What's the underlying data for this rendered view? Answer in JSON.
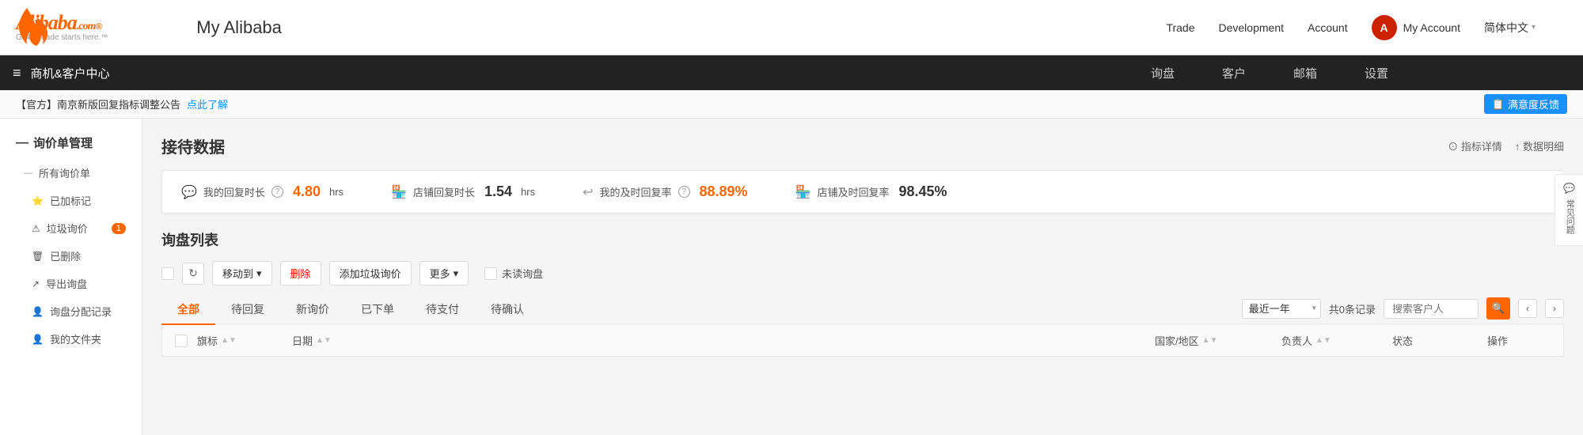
{
  "topNav": {
    "logo_brand": "Alibaba.com®",
    "logo_tagline": "Global trade starts here.™",
    "page_title": "My Alibaba",
    "links": [
      {
        "label": "Trade",
        "id": "trade"
      },
      {
        "label": "Development",
        "id": "development"
      },
      {
        "label": "Account",
        "id": "account"
      }
    ],
    "my_account_label": "My Account",
    "lang_label": "简体中文",
    "lang_arrow": "▾"
  },
  "secNav": {
    "menu_icon": "≡",
    "section_title": "商机&客户中心",
    "links": [
      {
        "label": "询盘",
        "id": "inquiry"
      },
      {
        "label": "客户",
        "id": "customer"
      },
      {
        "label": "邮箱",
        "id": "mailbox"
      },
      {
        "label": "设置",
        "id": "settings"
      }
    ]
  },
  "announcement": {
    "text": "【官方】南京新版回复指标调整公告",
    "link_text": "点此了解",
    "satisfaction_label": "满意度反馈",
    "indicator_label": "⊙ 指标详情",
    "data_label": "↑ 数据明细"
  },
  "sidebar": {
    "section_title": "询价单管理",
    "collapse_icon": "—",
    "items": [
      {
        "label": "所有询价单",
        "id": "all",
        "indent": false,
        "badge": null
      },
      {
        "label": "已加标记",
        "id": "marked",
        "indent": true,
        "badge": null
      },
      {
        "label": "垃圾询价",
        "id": "spam",
        "indent": true,
        "badge": "1"
      },
      {
        "label": "已删除",
        "id": "deleted",
        "indent": true,
        "badge": null
      },
      {
        "label": "导出询盘",
        "id": "export",
        "indent": true,
        "badge": null
      },
      {
        "label": "询盘分配记录",
        "id": "assign",
        "indent": true,
        "badge": null
      },
      {
        "label": "我的文件夹",
        "id": "folder",
        "indent": true,
        "badge": null
      }
    ]
  },
  "content": {
    "title": "接待数据",
    "header_links": [
      {
        "label": "⊙ 指标详情",
        "id": "indicator"
      },
      {
        "label": "↑ 数据明细",
        "id": "data_detail"
      }
    ],
    "stats": [
      {
        "icon": "💬",
        "label": "我的回复时长",
        "help": true,
        "value": "4.80",
        "unit": "hrs",
        "value_color": "orange",
        "id": "my-reply-time"
      },
      {
        "icon": "🏪",
        "label": "店铺回复时长",
        "help": false,
        "value": "1.54",
        "unit": "hrs",
        "value_color": "black",
        "id": "shop-reply-time"
      },
      {
        "icon": "↩",
        "label": "我的及时回复率",
        "help": true,
        "value": "88.89%",
        "unit": "",
        "value_color": "orange",
        "id": "my-reply-rate"
      },
      {
        "icon": "🏪",
        "label": "店铺及时回复率",
        "help": false,
        "value": "98.45%",
        "unit": "",
        "value_color": "black",
        "id": "shop-reply-rate"
      }
    ],
    "inquiry_list_title": "询盘列表",
    "toolbar": {
      "move_to": "移动到",
      "delete": "删除",
      "add_spam": "添加垃圾询价",
      "more": "更多",
      "unread": "未读询盘"
    },
    "tabs": [
      {
        "label": "全部",
        "active": true
      },
      {
        "label": "待回复",
        "active": false
      },
      {
        "label": "新询价",
        "active": false
      },
      {
        "label": "已下单",
        "active": false
      },
      {
        "label": "待支付",
        "active": false
      },
      {
        "label": "待确认",
        "active": false
      }
    ],
    "filter": {
      "period_label": "最近一年",
      "records_text": "共0条记录",
      "search_placeholder": "搜索客户人"
    },
    "table_headers": [
      {
        "label": "旗标",
        "sort": true
      },
      {
        "label": "日期",
        "sort": true
      },
      {
        "label": "",
        "sort": false
      },
      {
        "label": "国家/地区",
        "sort": true
      },
      {
        "label": "负责人",
        "sort": true
      },
      {
        "label": "状态",
        "sort": false
      },
      {
        "label": "操作",
        "sort": false
      }
    ],
    "right_panel": {
      "label": "常见问题"
    }
  }
}
